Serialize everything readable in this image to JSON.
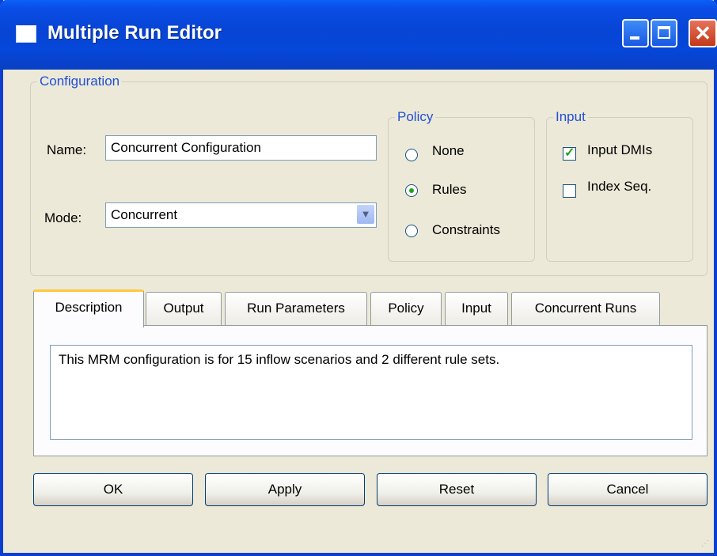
{
  "window": {
    "title": "Multiple Run Editor"
  },
  "configuration": {
    "legend": "Configuration",
    "name_label": "Name:",
    "name_value": "Concurrent Configuration",
    "mode_label": "Mode:",
    "mode_value": "Concurrent"
  },
  "policy": {
    "legend": "Policy",
    "options": [
      {
        "label": "None",
        "selected": false
      },
      {
        "label": "Rules",
        "selected": true
      },
      {
        "label": "Constraints",
        "selected": false
      }
    ]
  },
  "input": {
    "legend": "Input",
    "options": [
      {
        "label": "Input DMIs",
        "checked": true
      },
      {
        "label": "Index Seq.",
        "checked": false
      }
    ]
  },
  "tabs": [
    {
      "label": "Description",
      "active": true
    },
    {
      "label": "Output",
      "active": false
    },
    {
      "label": "Run Parameters",
      "active": false
    },
    {
      "label": "Policy",
      "active": false
    },
    {
      "label": "Input",
      "active": false
    },
    {
      "label": "Concurrent Runs",
      "active": false
    }
  ],
  "description": {
    "text": "This MRM configuration is for 15 inflow scenarios and 2 different rule sets."
  },
  "buttons": {
    "ok": "OK",
    "apply": "Apply",
    "reset": "Reset",
    "cancel": "Cancel"
  },
  "colors": {
    "titlebar": "#0a4de6",
    "window_bg": "#ece9d8",
    "group_legend": "#2150d6",
    "active_tab_accent": "#ffc83c"
  }
}
